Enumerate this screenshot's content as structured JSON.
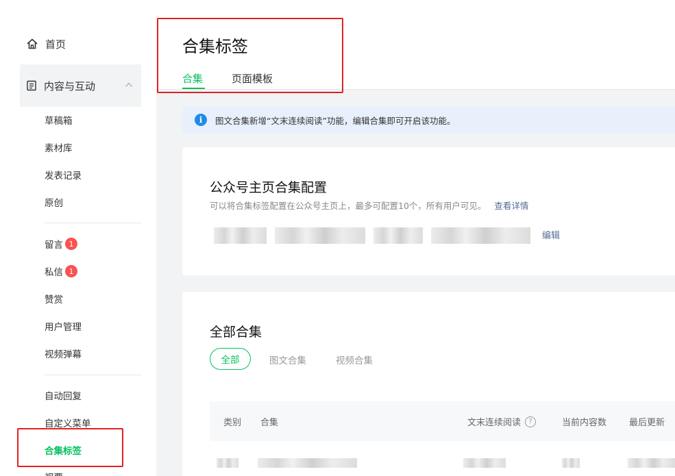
{
  "sidebar": {
    "home_label": "首页",
    "group_label": "内容与互动",
    "items": [
      {
        "label": "草稿箱"
      },
      {
        "label": "素材库"
      },
      {
        "label": "发表记录"
      },
      {
        "label": "原创"
      },
      {
        "label": "留言",
        "badge": "1"
      },
      {
        "label": "私信",
        "badge": "1"
      },
      {
        "label": "赞赏"
      },
      {
        "label": "用户管理"
      },
      {
        "label": "视频弹幕"
      },
      {
        "label": "自动回复"
      },
      {
        "label": "自定义菜单"
      },
      {
        "label": "合集标签"
      },
      {
        "label": "视要"
      }
    ],
    "active_item": "合集标签"
  },
  "header": {
    "title": "合集标签",
    "tabs": [
      {
        "label": "合集"
      },
      {
        "label": "页面模板"
      }
    ],
    "active_tab": "合集"
  },
  "notice": {
    "text": "图文合集新增“文末连续阅读”功能，编辑合集即可开启该功能。"
  },
  "homepage_config": {
    "title": "公众号主页合集配置",
    "description": "可以将合集标签配置在公众号主页上，最多可配置10个，所有用户可见。",
    "detail_link": "查看详情",
    "edit_link": "编辑"
  },
  "all_collections": {
    "title": "全部合集",
    "filters": [
      {
        "label": "全部"
      },
      {
        "label": "图文合集"
      },
      {
        "label": "视频合集"
      }
    ],
    "active_filter": "全部",
    "columns": [
      {
        "label": "类别"
      },
      {
        "label": "合集"
      },
      {
        "label": "文末连续阅读"
      },
      {
        "label": "当前内容数"
      },
      {
        "label": "最后更新"
      }
    ]
  },
  "colors": {
    "accent_green": "#07c160",
    "badge_red": "#fa5151",
    "link_blue": "#576b95",
    "info_blue": "#1f8ce6",
    "annotation_red": "#e02020"
  }
}
